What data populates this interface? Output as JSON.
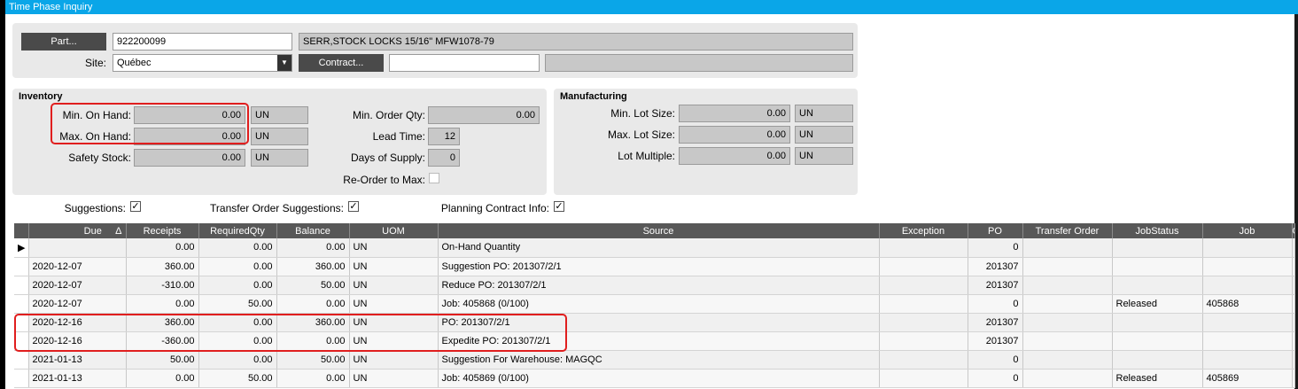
{
  "window": {
    "title": "Time Phase Inquiry"
  },
  "header": {
    "part_button": "Part...",
    "part_value": "922200099",
    "part_description": "SERR,STOCK LOCKS 15/16\" MFW1078-79",
    "site_label": "Site:",
    "site_value": "Québec",
    "contract_button": "Contract...",
    "contract_value": "",
    "contract_description": ""
  },
  "inventory": {
    "title": "Inventory",
    "min_on_hand_label": "Min. On Hand:",
    "min_on_hand": "0.00",
    "min_on_hand_uom": "UN",
    "max_on_hand_label": "Max. On Hand:",
    "max_on_hand": "0.00",
    "max_on_hand_uom": "UN",
    "safety_stock_label": "Safety Stock:",
    "safety_stock": "0.00",
    "safety_stock_uom": "UN",
    "min_order_qty_label": "Min. Order Qty:",
    "min_order_qty": "0.00",
    "lead_time_label": "Lead Time:",
    "lead_time": "12",
    "days_of_supply_label": "Days of Supply:",
    "days_of_supply": "0",
    "reorder_to_max_label": "Re-Order to Max:",
    "reorder_to_max": false
  },
  "manufacturing": {
    "title": "Manufacturing",
    "min_lot_label": "Min. Lot Size:",
    "min_lot": "0.00",
    "min_lot_uom": "UN",
    "max_lot_label": "Max. Lot Size:",
    "max_lot": "0.00",
    "max_lot_uom": "UN",
    "lot_multiple_label": "Lot Multiple:",
    "lot_multiple": "0.00",
    "lot_multiple_uom": "UN"
  },
  "options": {
    "suggestions_label": "Suggestions:",
    "suggestions": true,
    "transfer_label": "Transfer Order Suggestions:",
    "transfer": true,
    "planning_label": "Planning Contract Info:",
    "planning": true
  },
  "grid": {
    "columns": [
      "Due",
      "Receipts",
      "RequiredQty",
      "Balance",
      "UOM",
      "Source",
      "Exception",
      "PO",
      "Transfer Order",
      "JobStatus",
      "Job",
      "C"
    ],
    "sort_indicator": "Δ",
    "rows": [
      {
        "due": "",
        "receipts": "0.00",
        "required": "0.00",
        "balance": "0.00",
        "uom": "UN",
        "source": "On-Hand Quantity",
        "exception": "",
        "po": "0",
        "transfer": "",
        "jobstatus": "",
        "job": ""
      },
      {
        "due": "2020-12-07",
        "receipts": "360.00",
        "required": "0.00",
        "balance": "360.00",
        "uom": "UN",
        "source": "Suggestion PO: 201307/2/1",
        "exception": "",
        "po": "201307",
        "transfer": "",
        "jobstatus": "",
        "job": ""
      },
      {
        "due": "2020-12-07",
        "receipts": "-310.00",
        "required": "0.00",
        "balance": "50.00",
        "uom": "UN",
        "source": "Reduce PO: 201307/2/1",
        "exception": "",
        "po": "201307",
        "transfer": "",
        "jobstatus": "",
        "job": ""
      },
      {
        "due": "2020-12-07",
        "receipts": "0.00",
        "required": "50.00",
        "balance": "0.00",
        "uom": "UN",
        "source": "Job: 405868 (0/100)",
        "exception": "",
        "po": "0",
        "transfer": "",
        "jobstatus": "Released",
        "job": "405868"
      },
      {
        "due": "2020-12-16",
        "receipts": "360.00",
        "required": "0.00",
        "balance": "360.00",
        "uom": "UN",
        "source": "PO: 201307/2/1",
        "exception": "",
        "po": "201307",
        "transfer": "",
        "jobstatus": "",
        "job": ""
      },
      {
        "due": "2020-12-16",
        "receipts": "-360.00",
        "required": "0.00",
        "balance": "0.00",
        "uom": "UN",
        "source": "Expedite PO: 201307/2/1",
        "exception": "",
        "po": "201307",
        "transfer": "",
        "jobstatus": "",
        "job": ""
      },
      {
        "due": "2021-01-13",
        "receipts": "50.00",
        "required": "0.00",
        "balance": "50.00",
        "uom": "UN",
        "source": "Suggestion For Warehouse: MAGQC",
        "exception": "",
        "po": "0",
        "transfer": "",
        "jobstatus": "",
        "job": ""
      },
      {
        "due": "2021-01-13",
        "receipts": "0.00",
        "required": "50.00",
        "balance": "0.00",
        "uom": "UN",
        "source": "Job: 405869 (0/100)",
        "exception": "",
        "po": "0",
        "transfer": "",
        "jobstatus": "Released",
        "job": "405869"
      }
    ]
  },
  "colors": {
    "title_bar": "#0aa6e8",
    "highlight": "#e01e1e",
    "grid_header": "#585858"
  }
}
